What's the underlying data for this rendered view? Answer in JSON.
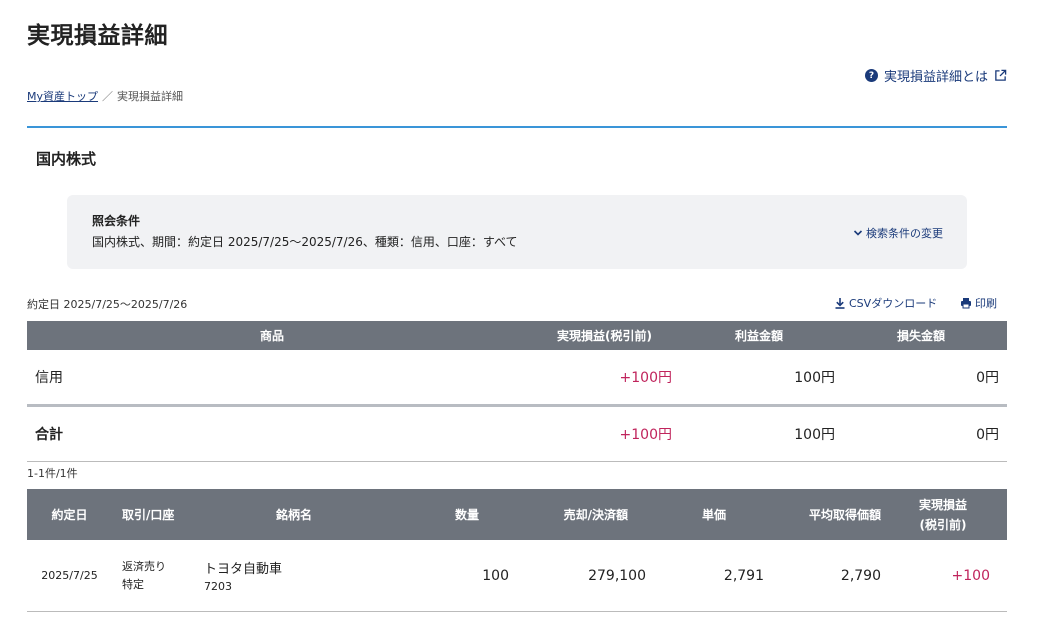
{
  "page": {
    "title": "実現損益詳細",
    "help_link": "実現損益詳細とは"
  },
  "breadcrumb": {
    "home": "My資産トップ",
    "sep": "／",
    "current": "実現損益詳細"
  },
  "section": {
    "title": "国内株式"
  },
  "conditions": {
    "heading": "照会条件",
    "text": "国内株式、期間：約定日 2025/7/25〜2025/7/26、種類：信用、口座：すべて",
    "change_label": "検索条件の変更"
  },
  "toolbar": {
    "period": "約定日 2025/7/25〜2025/7/26",
    "csv_label": "CSVダウンロード",
    "print_label": "印刷"
  },
  "summary": {
    "headers": [
      "商品",
      "実現損益(税引前)",
      "利益金額",
      "損失金額"
    ],
    "rows": [
      {
        "product": "信用",
        "pl": "+100円",
        "profit": "100円",
        "loss": "0円"
      }
    ],
    "total": {
      "product": "合計",
      "pl": "+100円",
      "profit": "100円",
      "loss": "0円"
    }
  },
  "count": "1-1件/1件",
  "detail": {
    "headers": {
      "date": "約定日",
      "trade": "取引/口座",
      "name": "銘柄名",
      "qty": "数量",
      "amount": "売却/決済額",
      "price": "単価",
      "avg": "平均取得価額",
      "pl_line1": "実現損益",
      "pl_line2": "(税引前)"
    },
    "rows": [
      {
        "date": "2025/7/25",
        "trade": "返済売り",
        "account": "特定",
        "name": "トヨタ自動車",
        "code": "7203",
        "qty": "100",
        "amount": "279,100",
        "price": "2,791",
        "avg": "2,790",
        "pl": "+100"
      }
    ]
  },
  "colors": {
    "accent": "#3a95d8",
    "header_bg": "#6d737c",
    "link": "#1a3a7a",
    "positive": "#c0245c",
    "cond_bg": "#f1f2f4"
  }
}
